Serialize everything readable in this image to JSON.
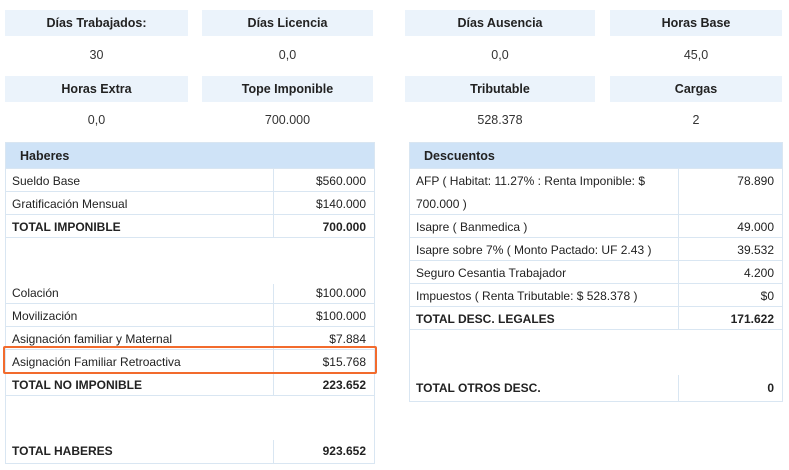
{
  "summary": {
    "dias_trabajados_label": "Días Trabajados:",
    "dias_trabajados_value": "30",
    "dias_licencia_label": "Días Licencia",
    "dias_licencia_value": "0,0",
    "dias_ausencia_label": "Días Ausencia",
    "dias_ausencia_value": "0,0",
    "horas_base_label": "Horas Base",
    "horas_base_value": "45,0",
    "horas_extra_label": "Horas Extra",
    "horas_extra_value": "0,0",
    "tope_imponible_label": "Tope Imponible",
    "tope_imponible_value": "700.000",
    "tributable_label": "Tributable",
    "tributable_value": "528.378",
    "cargas_label": "Cargas",
    "cargas_value": "2"
  },
  "haberes": {
    "title": "Haberes",
    "rows": [
      {
        "label": "Sueldo Base",
        "value": "$560.000"
      },
      {
        "label": "Gratificación Mensual",
        "value": "$140.000"
      },
      {
        "label": "TOTAL IMPONIBLE",
        "value": "700.000"
      },
      {
        "label": "",
        "value": ""
      },
      {
        "label": "Colación",
        "value": "$100.000"
      },
      {
        "label": "Movilización",
        "value": "$100.000"
      },
      {
        "label": "Asignación familiar y Maternal",
        "value": "$7.884"
      },
      {
        "label": "Asignación Familiar Retroactiva",
        "value": "$15.768"
      },
      {
        "label": "TOTAL NO IMPONIBLE",
        "value": "223.652"
      },
      {
        "label": "",
        "value": ""
      },
      {
        "label": "TOTAL HABERES",
        "value": "923.652"
      }
    ]
  },
  "descuentos": {
    "title": "Descuentos",
    "rows": [
      {
        "label": "AFP ( Habitat: 11.27% : Renta Imponible: $",
        "label2": "700.000 )",
        "value": "78.890"
      },
      {
        "label": "Isapre ( Banmedica )",
        "value": "49.000"
      },
      {
        "label": "Isapre sobre 7% ( Monto Pactado: UF 2.43 )",
        "value": "39.532"
      },
      {
        "label": "Seguro Cesantia Trabajador",
        "value": "4.200"
      },
      {
        "label": "Impuestos ( Renta Tributable: $ 528.378 )",
        "value": "$0"
      },
      {
        "label": "TOTAL DESC. LEGALES",
        "value": "171.622"
      },
      {
        "label": "",
        "value": ""
      },
      {
        "label": "TOTAL OTROS DESC.",
        "value": "0"
      }
    ]
  },
  "colors": {
    "label_bg": "#ebf3fb",
    "header_bg": "#cfe3f7",
    "border": "#d9e6f2",
    "highlight": "#f26b2d"
  }
}
